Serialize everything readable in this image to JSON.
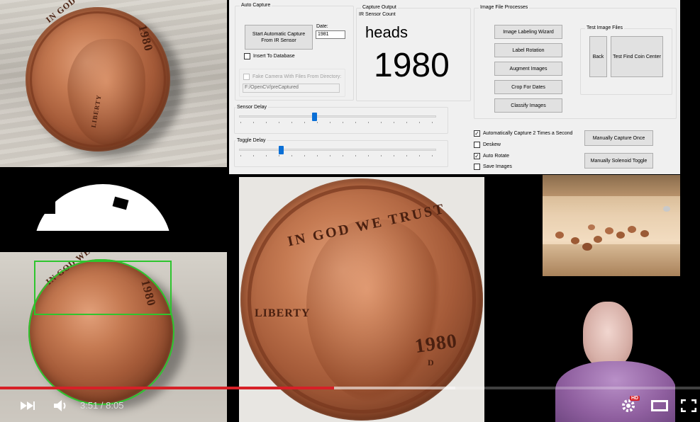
{
  "auto_capture": {
    "group_title": "Auto Capture",
    "start_button": "Start Automatic Capture From IR Sensor",
    "date_label": "Date:",
    "date_value": "1981",
    "insert_db_label": "Insert To Database",
    "fake_camera_label": "Fake Camera With Files From Directory:",
    "directory_value": "F:/OpenCV/preCaptured"
  },
  "capture_output": {
    "group_title": "Capture Output",
    "ir_count_label": "IR Sensor Count",
    "side": "heads",
    "year": "1980"
  },
  "image_file_processes": {
    "group_title": "Image File Processes",
    "buttons": [
      "Image Labeling Wizard",
      "Label Rotation",
      "Augment Images",
      "Crop For Dates",
      "Classify Images"
    ]
  },
  "test_image_files": {
    "group_title": "Test Image Files",
    "back_button": "Back",
    "find_center_button": "Test Find Coin Center"
  },
  "sliders": {
    "sensor_delay_label": "Sensor Delay",
    "sensor_delay_value": 0.37,
    "toggle_delay_label": "Toggle Delay",
    "toggle_delay_value": 0.2
  },
  "options": {
    "auto_capture_label": "Automatically Capture 2 Times a Second",
    "auto_capture_checked": true,
    "deskew_label": "Deskew",
    "deskew_checked": false,
    "auto_rotate_label": "Auto Rotate",
    "auto_rotate_checked": true,
    "save_images_label": "Save Images",
    "save_images_checked": false
  },
  "manual": {
    "capture_once_button": "Manually Capture Once",
    "solenoid_button": "Manually Solenoid Toggle"
  },
  "coin": {
    "motto": "IN GOD WE TRUST",
    "liberty": "LIBERTY",
    "year": "1980",
    "mint": "D"
  },
  "player": {
    "time_display": "3:51 / 8:05",
    "progress": 0.477,
    "buffered": 0.65,
    "hd_badge": "HD",
    "icons": [
      "next-icon",
      "volume-icon",
      "settings-icon",
      "theater-icon",
      "fullscreen-icon"
    ]
  },
  "colors": {
    "progress_red": "#d72027",
    "detect_green": "#2ec52e",
    "slider_blue": "#0a6fd6"
  }
}
